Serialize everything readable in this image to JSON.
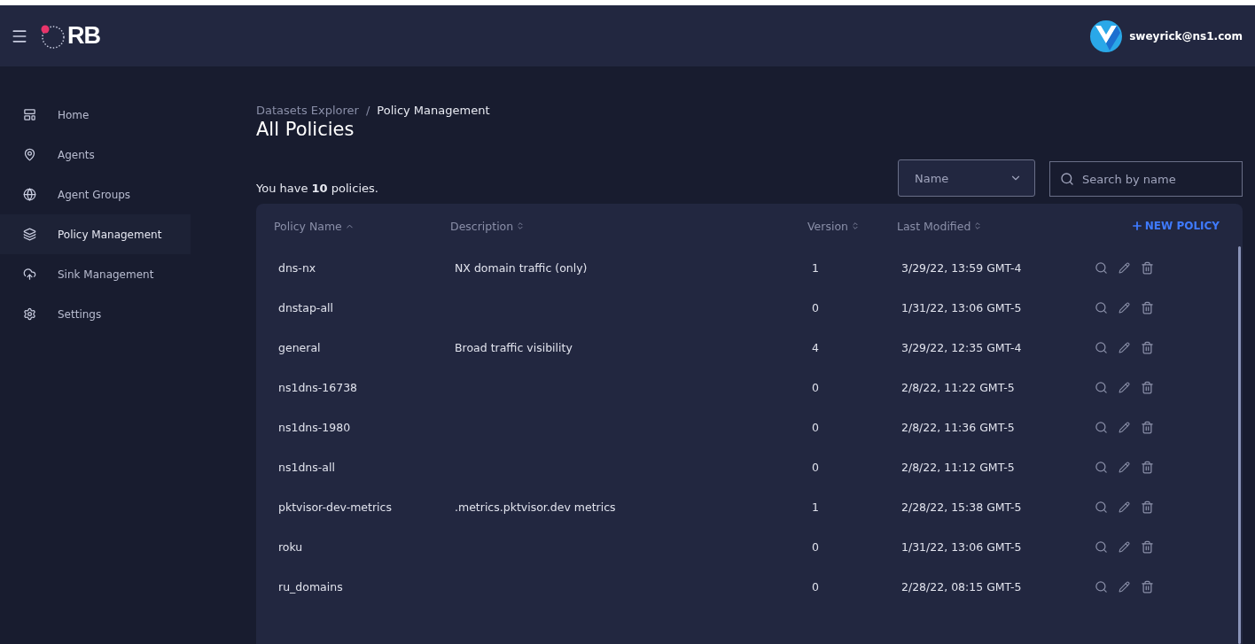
{
  "header": {
    "logo_text": "RB",
    "user": "sweyrick@ns1.com"
  },
  "sidebar": {
    "items": [
      {
        "label": "Home",
        "selected": false
      },
      {
        "label": "Agents",
        "selected": false
      },
      {
        "label": "Agent Groups",
        "selected": false
      },
      {
        "label": "Policy Management",
        "selected": true
      },
      {
        "label": "Sink Management",
        "selected": false
      },
      {
        "label": "Settings",
        "selected": false
      }
    ]
  },
  "breadcrumb": [
    {
      "label": "Datasets Explorer",
      "current": false
    },
    {
      "label": "Policy Management",
      "current": true
    }
  ],
  "breadcrumb_separator": "/",
  "page_title": "All Policies",
  "summary": "You have **10** policies.",
  "filter_select": {
    "value": "Name"
  },
  "search": {
    "placeholder": "Search by name"
  },
  "table": {
    "columns": [
      {
        "label": "Policy Name",
        "sorted": true
      },
      {
        "label": "Description",
        "sorted": false
      },
      {
        "label": "Version",
        "sorted": false
      },
      {
        "label": "Last Modified",
        "sorted": false
      }
    ],
    "new_button": "NEW POLICY",
    "rows": [
      [
        "dns-nx",
        "NX domain traffic (only)",
        "1",
        "3/29/22, 13:59 GMT-4"
      ],
      [
        "dnstap-all",
        "",
        "0",
        "1/31/22, 13:06 GMT-5"
      ],
      [
        "general",
        "Broad traffic visibility",
        "4",
        "3/29/22, 12:35 GMT-4"
      ],
      [
        "ns1dns-16738",
        "",
        "0",
        "2/8/22, 11:22 GMT-5"
      ],
      [
        "ns1dns-1980",
        "",
        "0",
        "2/8/22, 11:36 GMT-5"
      ],
      [
        "ns1dns-all",
        "",
        "0",
        "2/8/22, 11:12 GMT-5"
      ],
      [
        "pktvisor-dev-metrics",
        ".metrics.pktvisor.dev metrics",
        "1",
        "2/28/22, 15:38 GMT-5"
      ],
      [
        "roku",
        "",
        "0",
        "1/31/22, 13:06 GMT-5"
      ],
      [
        "ru_domains",
        "",
        "0",
        "2/28/22, 08:15 GMT-5"
      ]
    ]
  }
}
